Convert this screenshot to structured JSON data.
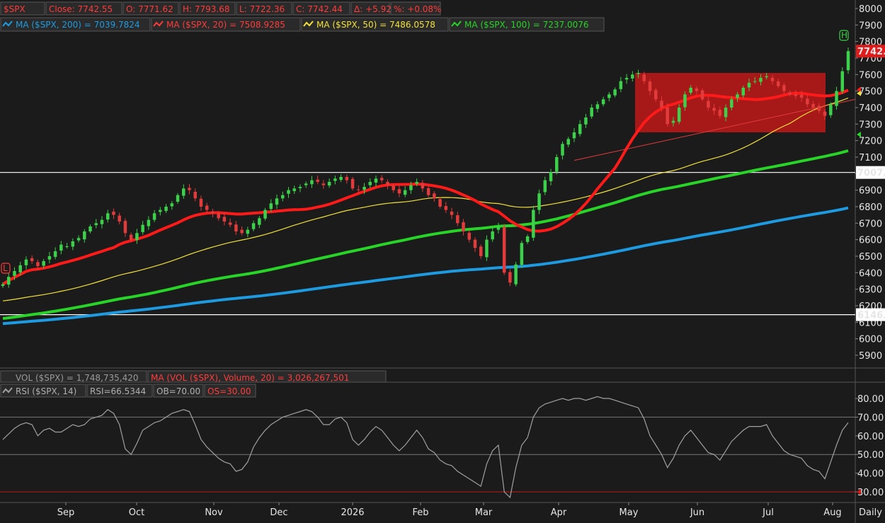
{
  "header": {
    "symbol": "$SPX",
    "close": "Close: 7742.55",
    "open": "O: 7771.62",
    "high": "H: 7793.68",
    "low": "L: 7722.36",
    "last": "C: 7742.44",
    "change": "Δ: +5.92",
    "pct": "%: +0.08%"
  },
  "legend": {
    "ma200": "MA ($SPX, 200) = 7039.7824",
    "ma20": "MA ($SPX, 20) = 7508.9285",
    "ma50": "MA ($SPX, 50) = 7486.0578",
    "ma100": "MA ($SPX, 100) = 7237.0076"
  },
  "volume_legend": {
    "vol": "VOL ($SPX) = 1,748,735,420",
    "ma": "MA (VOL ($SPX), Volume, 20) = 3,026,267,501"
  },
  "rsi_legend": {
    "rsi": "RSI ($SPX, 14)",
    "value": "RSI=66.5344",
    "ob": "OB=70.00",
    "os": "OS=30.00"
  },
  "badges": {
    "last_price": "7742.",
    "hline_upper": "7007.",
    "hline_lower": "6146.",
    "start_marker": "L",
    "end_marker": "H"
  },
  "periodicity": "Daily",
  "colors": {
    "background": "#1b1b1b",
    "up_candle": "#3bd14a",
    "down_candle": "#e23b3b",
    "ma20": "#ff1a1a",
    "ma50": "#f2e03b",
    "ma100": "#27d427",
    "ma200": "#1e9be0",
    "box": "#c01818",
    "rsi": "#a0a0a0"
  },
  "chart_data": [
    {
      "type": "candlestick",
      "title": "$SPX",
      "y_ticks": [
        5900,
        6000,
        6100,
        6200,
        6300,
        6400,
        6500,
        6600,
        6700,
        6800,
        6900,
        7000,
        7100,
        7200,
        7300,
        7400,
        7500,
        7600,
        7700,
        7800,
        7900,
        8000
      ],
      "ylim": [
        5850,
        8000
      ],
      "x_labels": [
        "Sep",
        "Oct",
        "Nov",
        "Dec",
        "2026",
        "Feb",
        "Mar",
        "Apr",
        "May",
        "Jun",
        "Jul",
        "Aug"
      ],
      "horizontal_lines": [
        7007,
        6146
      ],
      "trading_range_box": {
        "low": 7250,
        "high": 7610,
        "from": "May",
        "to": "late Jul"
      },
      "close_series": [
        6330,
        6375,
        6410,
        6445,
        6480,
        6470,
        6440,
        6470,
        6500,
        6530,
        6570,
        6560,
        6590,
        6610,
        6650,
        6680,
        6700,
        6720,
        6760,
        6750,
        6710,
        6640,
        6600,
        6640,
        6690,
        6720,
        6760,
        6780,
        6800,
        6820,
        6870,
        6910,
        6900,
        6850,
        6800,
        6780,
        6760,
        6730,
        6710,
        6690,
        6650,
        6640,
        6660,
        6700,
        6730,
        6780,
        6820,
        6850,
        6870,
        6900,
        6910,
        6920,
        6940,
        6960,
        6950,
        6930,
        6950,
        6970,
        6980,
        6960,
        6910,
        6900,
        6920,
        6950,
        6970,
        6960,
        6930,
        6900,
        6880,
        6900,
        6930,
        6950,
        6910,
        6870,
        6850,
        6800,
        6780,
        6750,
        6700,
        6650,
        6600,
        6550,
        6500,
        6600,
        6650,
        6680,
        6400,
        6340,
        6450,
        6580,
        6620,
        6780,
        6880,
        6960,
        7010,
        7100,
        7180,
        7210,
        7250,
        7300,
        7340,
        7400,
        7420,
        7450,
        7480,
        7510,
        7560,
        7580,
        7600,
        7610,
        7560,
        7500,
        7450,
        7400,
        7300,
        7320,
        7400,
        7480,
        7520,
        7500,
        7450,
        7400,
        7380,
        7350,
        7400,
        7450,
        7480,
        7520,
        7550,
        7560,
        7580,
        7590,
        7560,
        7530,
        7500,
        7480,
        7470,
        7460,
        7420,
        7400,
        7380,
        7350,
        7420,
        7500,
        7620,
        7742
      ],
      "series": [
        {
          "name": "MA ($SPX, 200)",
          "last": 7039.7824
        },
        {
          "name": "MA ($SPX, 20)",
          "last": 7508.9285
        },
        {
          "name": "MA ($SPX, 50)",
          "last": 7486.0578
        },
        {
          "name": "MA ($SPX, 100)",
          "last": 7237.0076
        }
      ]
    },
    {
      "type": "line",
      "title": "RSI ($SPX, 14)",
      "y_ticks": [
        30,
        40,
        50,
        60,
        70,
        80
      ],
      "ylim": [
        27,
        85
      ],
      "reference_lines": [
        70,
        50,
        30
      ],
      "values": [
        58,
        61,
        64,
        66,
        67,
        66,
        60,
        63,
        64,
        62,
        62,
        64,
        66,
        65,
        66,
        69,
        70,
        71,
        74,
        72,
        66,
        53,
        50,
        56,
        63,
        65,
        67,
        68,
        70,
        72,
        73,
        74,
        73,
        66,
        58,
        54,
        51,
        48,
        46,
        45,
        41,
        42,
        46,
        54,
        59,
        63,
        66,
        68,
        70,
        71,
        72,
        73,
        74,
        73,
        70,
        66,
        66,
        69,
        70,
        67,
        58,
        55,
        58,
        62,
        65,
        63,
        59,
        55,
        52,
        55,
        59,
        63,
        59,
        53,
        51,
        47,
        45,
        44,
        41,
        39,
        37,
        35,
        33,
        45,
        52,
        55,
        30,
        27,
        43,
        55,
        59,
        70,
        75,
        77,
        78,
        79,
        80,
        79,
        80,
        80,
        79,
        80,
        81,
        80,
        80,
        79,
        78,
        77,
        76,
        75,
        69,
        60,
        55,
        50,
        43,
        48,
        55,
        60,
        63,
        59,
        55,
        51,
        50,
        47,
        52,
        57,
        60,
        63,
        65,
        65,
        65,
        66,
        60,
        56,
        52,
        50,
        49,
        48,
        44,
        42,
        41,
        37,
        46,
        55,
        63,
        67
      ]
    }
  ]
}
